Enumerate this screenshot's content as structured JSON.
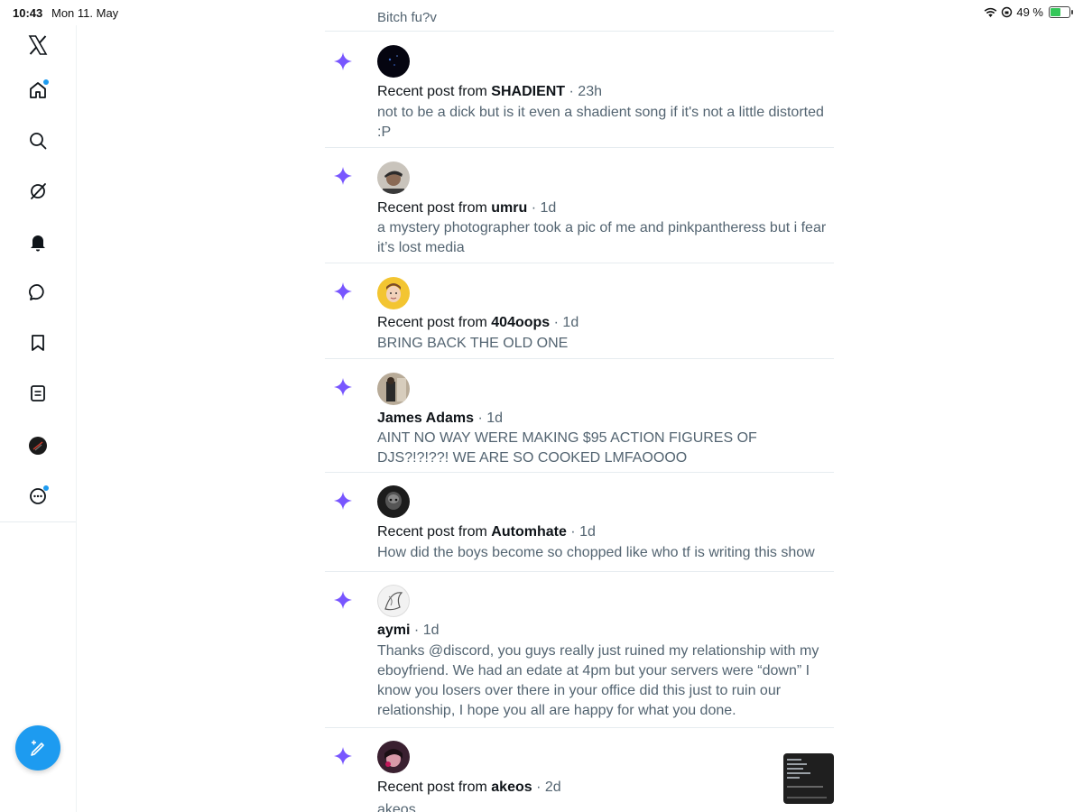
{
  "status_bar": {
    "time": "10:43",
    "date": "Mon 11. May",
    "battery_percent": "49 %",
    "battery_level": 0.49
  },
  "sidebar": {
    "items": [
      {
        "name": "x-logo-icon"
      },
      {
        "name": "home-icon",
        "notification_dot": true
      },
      {
        "name": "search-icon"
      },
      {
        "name": "grok-icon"
      },
      {
        "name": "notifications-icon"
      },
      {
        "name": "messages-icon"
      },
      {
        "name": "bookmarks-icon"
      },
      {
        "name": "lists-icon"
      },
      {
        "name": "profile-avatar"
      },
      {
        "name": "more-icon",
        "notification_dot": true
      }
    ],
    "compose_icon": "compose-post-icon"
  },
  "feed": {
    "top_partial_text": "Bitch fu?v",
    "accent_color": "#7856ff",
    "items": [
      {
        "prefix": "Recent post from ",
        "author": "SHADIENT",
        "time": "· 23h",
        "text": "not to be a dick but is it even a shadient song if it's not a little distorted :P"
      },
      {
        "prefix": "Recent post from ",
        "author": "umru",
        "time": "· 1d",
        "text": "a mystery photographer took a pic of me and pinkpantheress but i fear it’s lost media"
      },
      {
        "prefix": "Recent post from ",
        "author": "404oops",
        "time": "· 1d",
        "text": "BRING BACK THE OLD ONE"
      },
      {
        "prefix": "",
        "author": "James Adams",
        "time": "· 1d",
        "text": "AINT NO WAY WERE MAKING $95 ACTION FIGURES OF DJS?!?!??! WE ARE SO COOKED LMFAOOOO"
      },
      {
        "prefix": "Recent post from ",
        "author": "Automhate",
        "time": "· 1d",
        "text": "How did the boys become so chopped like who tf is writing this show"
      },
      {
        "prefix": "",
        "author": "aymi",
        "time": "· 1d",
        "text": "Thanks @discord, you guys really just ruined my relationship with my eboyfriend. We had an edate at 4pm but your servers were “down” I know you losers over there in your office did this just to ruin our relationship, I hope you all are happy for what you done."
      },
      {
        "prefix": "Recent post from ",
        "author": "akeos",
        "time": "· 2d",
        "text": "akeos"
      }
    ]
  }
}
